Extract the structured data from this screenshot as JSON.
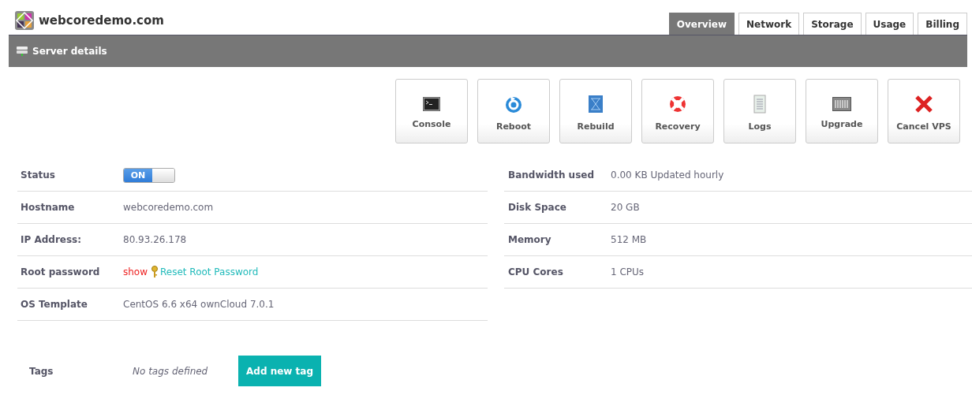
{
  "header": {
    "title": "webcoredemo.com"
  },
  "tabs": [
    {
      "label": "Overview",
      "selected": true
    },
    {
      "label": "Network",
      "selected": false
    },
    {
      "label": "Storage",
      "selected": false
    },
    {
      "label": "Usage",
      "selected": false
    },
    {
      "label": "Billing",
      "selected": false
    }
  ],
  "section_bar": {
    "title": "Server details"
  },
  "actions": [
    {
      "label": "Console"
    },
    {
      "label": "Reboot"
    },
    {
      "label": "Rebuild"
    },
    {
      "label": "Recovery"
    },
    {
      "label": "Logs"
    },
    {
      "label": "Upgrade"
    },
    {
      "label": "Cancel VPS"
    }
  ],
  "details_left": [
    {
      "kind": "toggle",
      "label": "Status",
      "toggle_text": "ON",
      "on": true
    },
    {
      "kind": "text",
      "label": "Hostname",
      "value": "webcoredemo.com"
    },
    {
      "kind": "text",
      "label": "IP Address:",
      "value": "80.93.26.178"
    },
    {
      "kind": "password",
      "label": "Root password",
      "show_link": "show",
      "reset_link": "Reset Root Password"
    },
    {
      "kind": "text",
      "label": "OS Template",
      "value": "CentOS 6.6 x64 ownCloud 7.0.1"
    }
  ],
  "details_right": [
    {
      "kind": "text",
      "label": "Bandwidth used",
      "value": "0.00 KB Updated hourly"
    },
    {
      "kind": "text",
      "label": "Disk Space",
      "value": "20 GB"
    },
    {
      "kind": "text",
      "label": "Memory",
      "value": "512 MB"
    },
    {
      "kind": "text",
      "label": "CPU Cores",
      "value": "1 CPUs"
    }
  ],
  "tags": {
    "label": "Tags",
    "empty_text": "No tags defined",
    "add_button": "Add new tag"
  }
}
